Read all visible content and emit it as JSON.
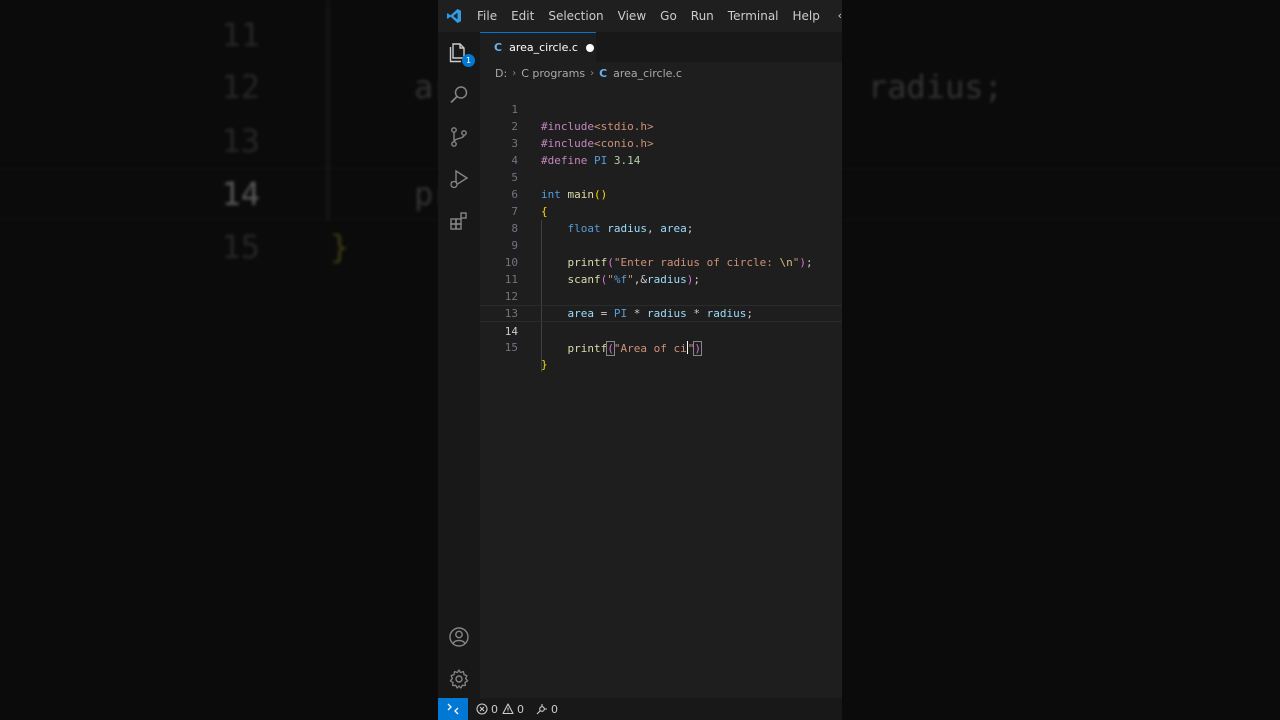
{
  "backdrop": {
    "line_numbers": [
      "11",
      "12",
      "13",
      "14",
      "15"
    ],
    "fragments": [
      "ar",
      "radius;",
      "pr",
      "}"
    ]
  },
  "titlebar": {
    "menu": [
      "File",
      "Edit",
      "Selection",
      "View",
      "Go",
      "Run",
      "Terminal",
      "Help"
    ]
  },
  "activity": {
    "explorer_badge": "1"
  },
  "tab": {
    "label": "area_circle.c",
    "lang": "C"
  },
  "breadcrumb": {
    "drive": "D:",
    "folder": "C programs",
    "file_icon": "C",
    "file": "area_circle.c"
  },
  "code": {
    "line_numbers": [
      "1",
      "2",
      "3",
      "4",
      "5",
      "6",
      "7",
      "8",
      "9",
      "10",
      "11",
      "12",
      "13",
      "14",
      "15"
    ],
    "current_line": 14
  },
  "statusbar": {
    "errors": "0",
    "warnings": "0",
    "ports": "0"
  },
  "colors": {
    "accent": "#0078d4",
    "editor_bg": "#1e1e1e"
  }
}
